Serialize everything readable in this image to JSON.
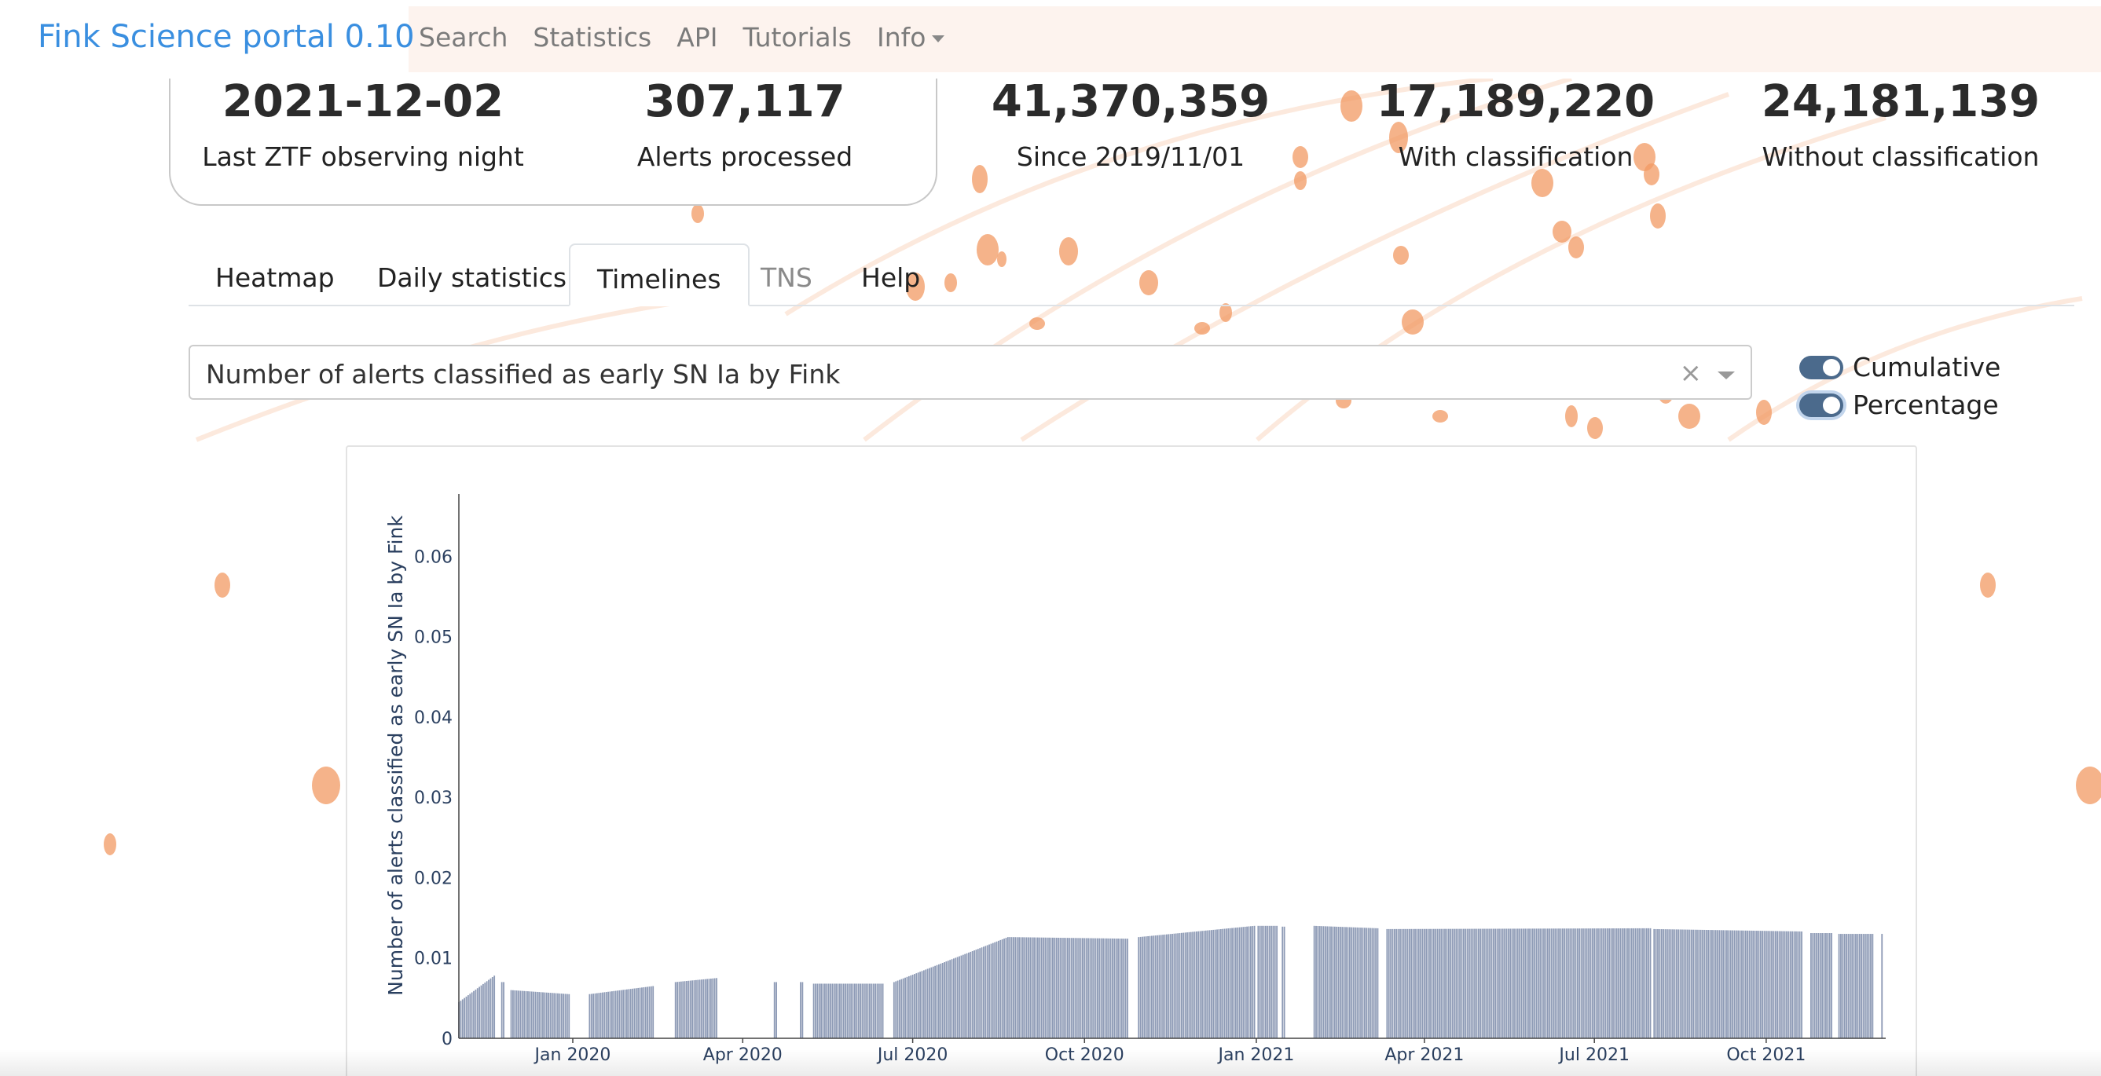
{
  "navbar": {
    "brand": "Fink Science portal 0.10",
    "links": [
      {
        "label": "Search"
      },
      {
        "label": "Statistics"
      },
      {
        "label": "API"
      },
      {
        "label": "Tutorials"
      },
      {
        "label": "Info",
        "has_caret": true
      }
    ]
  },
  "stats": [
    {
      "value": "2021-12-02",
      "label": "Last ZTF observing night"
    },
    {
      "value": "307,117",
      "label": "Alerts processed"
    },
    {
      "value": "41,370,359",
      "label": "Since 2019/11/01"
    },
    {
      "value": "17,189,220",
      "label": "With classification"
    },
    {
      "value": "24,181,139",
      "label": "Without classification"
    }
  ],
  "tabs": [
    {
      "label": "Heatmap",
      "state": "normal"
    },
    {
      "label": "Daily statistics",
      "state": "normal"
    },
    {
      "label": "Timelines",
      "state": "active"
    },
    {
      "label": "TNS",
      "state": "disabled"
    },
    {
      "label": "Help",
      "state": "normal"
    }
  ],
  "selector": {
    "value": "Number of alerts classified as early SN Ia by Fink",
    "clear_symbol": "×"
  },
  "toggles": [
    {
      "label": "Cumulative",
      "on": true
    },
    {
      "label": "Percentage",
      "on": true
    }
  ],
  "colors": {
    "brand": "#3a8fe0",
    "bar": "#8d9ab5",
    "toggle": "#4b6a8c",
    "background_motif": "#f29a63"
  },
  "chart_data": {
    "type": "bar",
    "ylabel": "Number of alerts classified as early SN Ia by Fink",
    "ylim": [
      0,
      0.066
    ],
    "yticks": [
      0,
      0.01,
      0.02,
      0.03,
      0.04,
      0.05,
      0.06
    ],
    "ytick_labels": [
      "0",
      "0.01",
      "0.02",
      "0.03",
      "0.04",
      "0.05",
      "0.06"
    ],
    "xlim": [
      "2019-11-01",
      "2021-12-04"
    ],
    "xticks": [
      "2020-01-01",
      "2020-04-01",
      "2020-07-01",
      "2020-10-01",
      "2021-01-01",
      "2021-04-01",
      "2021-07-01",
      "2021-10-01"
    ],
    "xtick_labels": [
      "Jan 2020",
      "Apr 2020",
      "Jul 2020",
      "Oct 2020",
      "Jan 2021",
      "Apr 2021",
      "Jul 2021",
      "Oct 2021"
    ],
    "bar_color": "#8d9ab5",
    "segments": [
      {
        "start": "2019-11-01",
        "end": "2019-11-20",
        "y_start": 0.0045,
        "y_end": 0.0078
      },
      {
        "start": "2019-11-24",
        "end": "2019-11-25",
        "y_start": 0.007,
        "y_end": 0.007
      },
      {
        "start": "2019-11-29",
        "end": "2019-12-30",
        "y_start": 0.006,
        "y_end": 0.0055
      },
      {
        "start": "2020-01-10",
        "end": "2020-02-13",
        "y_start": 0.0055,
        "y_end": 0.0065
      },
      {
        "start": "2020-02-25",
        "end": "2020-03-18",
        "y_start": 0.007,
        "y_end": 0.0075
      },
      {
        "start": "2020-04-18",
        "end": "2020-04-19",
        "y_start": 0.007,
        "y_end": 0.007
      },
      {
        "start": "2020-05-02",
        "end": "2020-05-03",
        "y_start": 0.007,
        "y_end": 0.007
      },
      {
        "start": "2020-05-09",
        "end": "2020-06-15",
        "y_start": 0.0068,
        "y_end": 0.0068
      },
      {
        "start": "2020-06-21",
        "end": "2020-08-21",
        "y_start": 0.007,
        "y_end": 0.0126
      },
      {
        "start": "2020-08-22",
        "end": "2020-10-24",
        "y_start": 0.0126,
        "y_end": 0.0124
      },
      {
        "start": "2020-10-30",
        "end": "2020-12-31",
        "y_start": 0.0126,
        "y_end": 0.014
      },
      {
        "start": "2021-01-02",
        "end": "2021-01-12",
        "y_start": 0.014,
        "y_end": 0.014
      },
      {
        "start": "2021-01-15",
        "end": "2021-01-16",
        "y_start": 0.0139,
        "y_end": 0.0139
      },
      {
        "start": "2021-02-01",
        "end": "2021-03-07",
        "y_start": 0.014,
        "y_end": 0.0137
      },
      {
        "start": "2021-03-12",
        "end": "2021-07-31",
        "y_start": 0.0136,
        "y_end": 0.0137
      },
      {
        "start": "2021-08-02",
        "end": "2021-10-20",
        "y_start": 0.0136,
        "y_end": 0.0133
      },
      {
        "start": "2021-10-25",
        "end": "2021-11-05",
        "y_start": 0.0131,
        "y_end": 0.0131
      },
      {
        "start": "2021-11-09",
        "end": "2021-11-27",
        "y_start": 0.013,
        "y_end": 0.013
      },
      {
        "start": "2021-12-02",
        "end": "2021-12-02",
        "y_start": 0.013,
        "y_end": 0.013
      }
    ]
  }
}
